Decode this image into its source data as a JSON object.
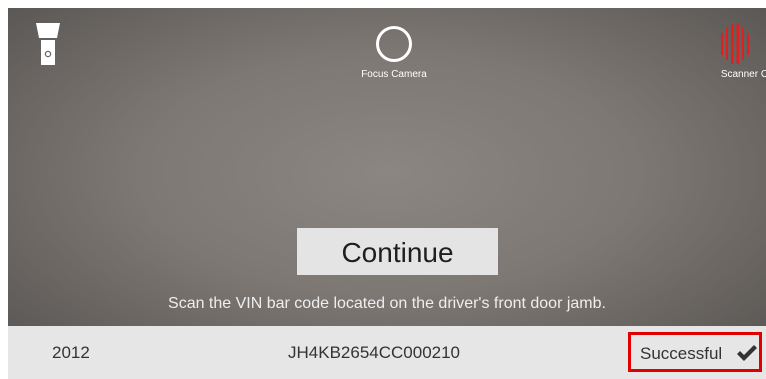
{
  "toolbar": {
    "flashlight_icon": "flashlight-icon",
    "focus_label": "Focus Camera",
    "scanner_label": "Scanner Off",
    "scanner_color": "#e02020"
  },
  "scan": {
    "continue_label": "Continue",
    "instruction": "Scan the VIN bar code located on the driver's front door jamb."
  },
  "result": {
    "year": "2012",
    "vin": "JH4KB2654CC000210",
    "status": "Successful",
    "status_icon": "check-icon",
    "highlight_color": "#e00000"
  }
}
